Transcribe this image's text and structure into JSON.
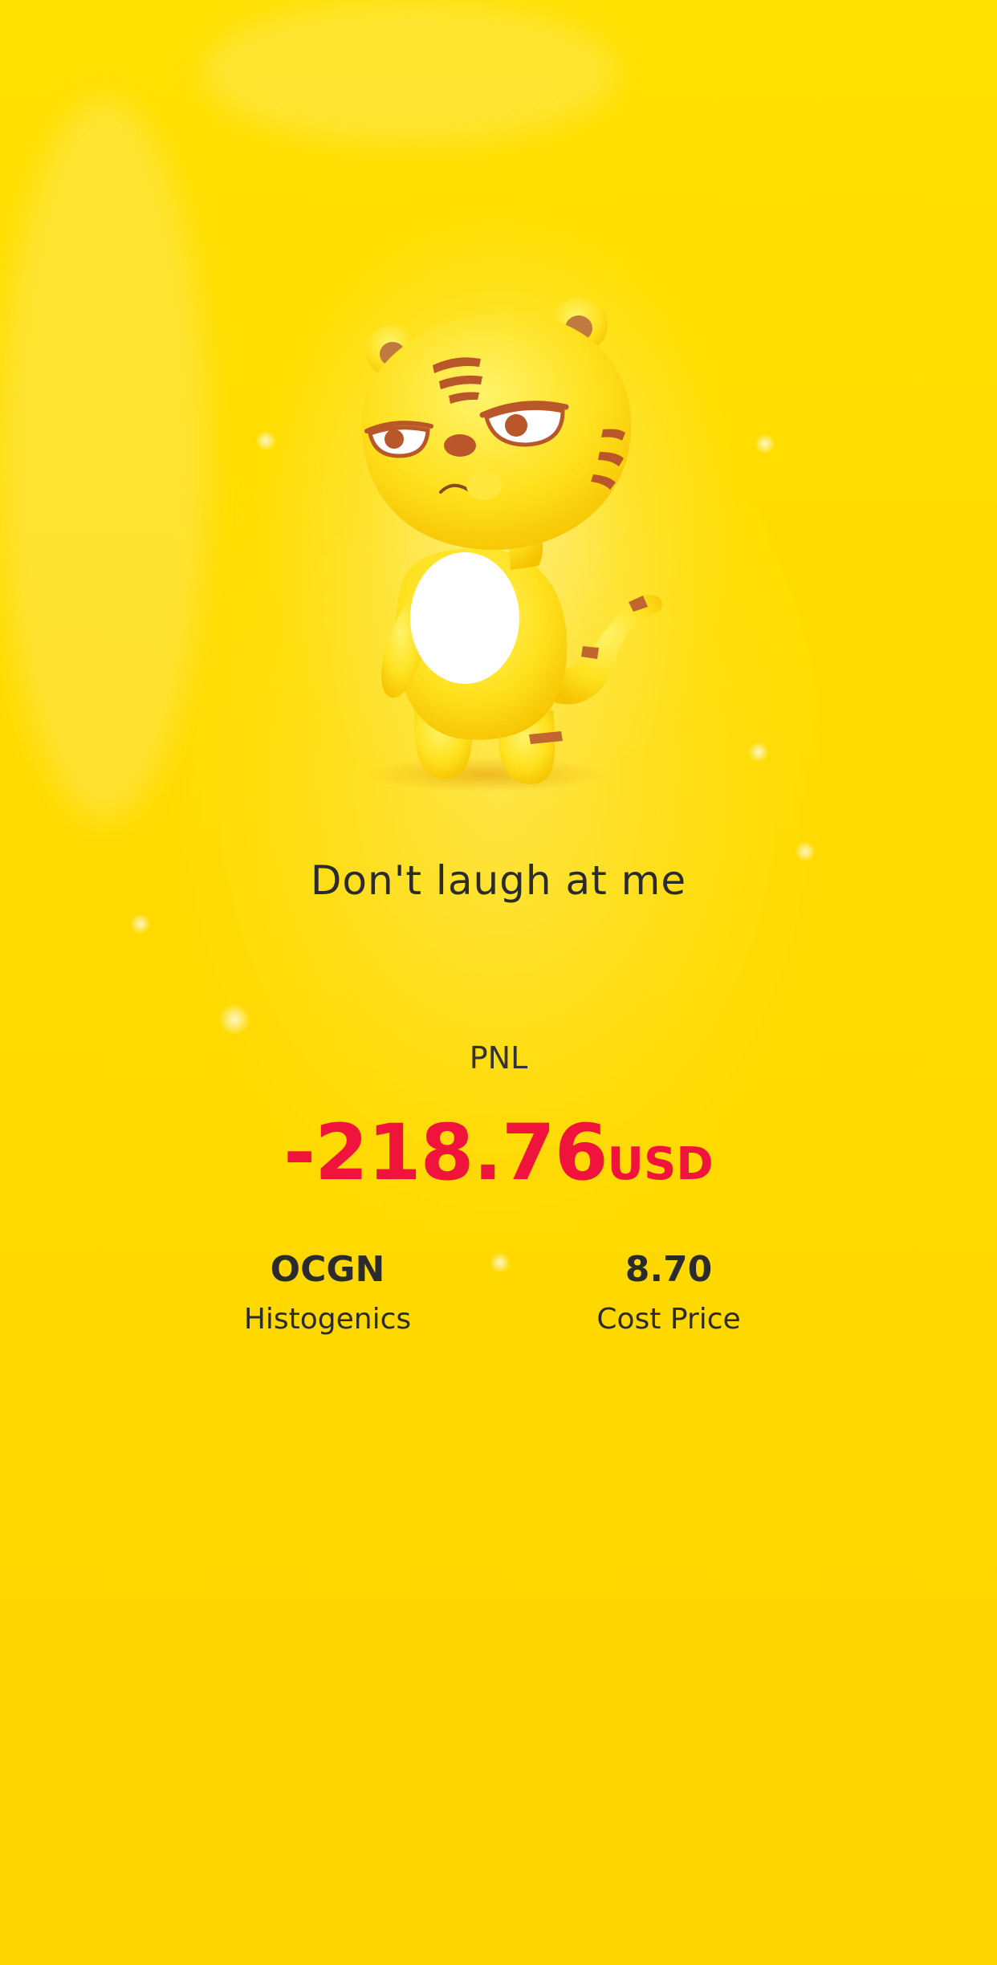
{
  "card": {
    "tagline": "Don't laugh at me",
    "pnl_label": "PNL",
    "pnl_amount": "-218.76",
    "pnl_unit": "USD",
    "stock_symbol": "OCGN",
    "stock_name": "Histogenics",
    "cost_value": "8.70",
    "cost_label": "Cost Price"
  },
  "colors": {
    "background": "#FFD800",
    "loss": "#F0143C",
    "text": "#2B2B2B"
  },
  "icons": {
    "mascot": "tiger-mascot-illustration"
  }
}
